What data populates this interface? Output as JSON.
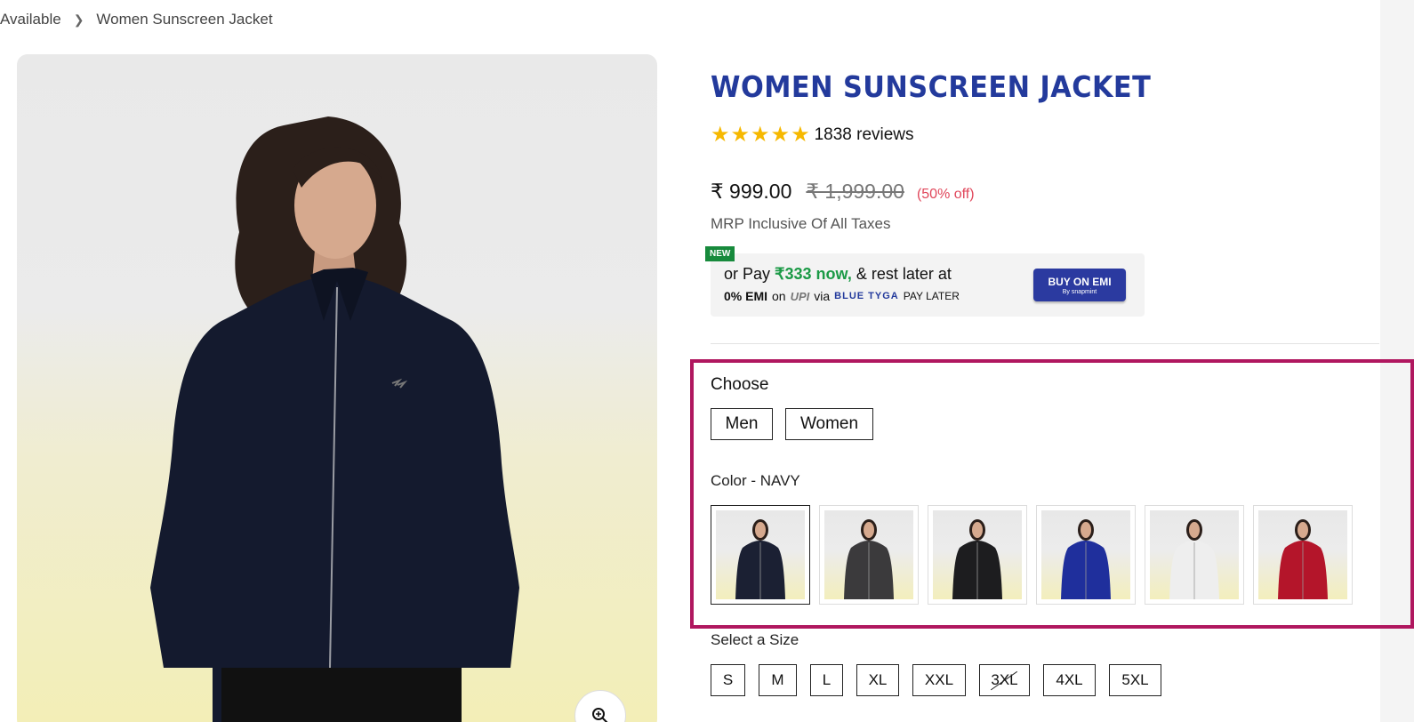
{
  "breadcrumb": {
    "parent": "Available",
    "current": "Women Sunscreen Jacket"
  },
  "product": {
    "title": "WOMEN SUNSCREEN JACKET",
    "rating_stars": 5,
    "reviews": "1838 reviews",
    "price": "₹ 999.00",
    "mrp": "₹ 1,999.00",
    "discount": "(50% off)",
    "tax_note": "MRP Inclusive Of All Taxes"
  },
  "emi": {
    "new_tag": "NEW",
    "line1_prefix": "or Pay ",
    "line1_highlight": "₹333 now,",
    "line1_suffix": " & rest later at",
    "line2_bold": "0% EMI",
    "line2_on": "on",
    "line2_upi": "UPI",
    "line2_via": "via",
    "line2_brand": "BLUE TYGA",
    "line2_paylater": "PAY LATER",
    "button_label": "BUY ON EMI",
    "button_sub": "By snapmint"
  },
  "choose": {
    "label": "Choose",
    "options": [
      "Men",
      "Women"
    ]
  },
  "color": {
    "label": "Color - NAVY",
    "swatches": [
      {
        "name": "navy",
        "color": "#1b2033",
        "selected": true
      },
      {
        "name": "charcoal",
        "color": "#3b3a3c",
        "selected": false
      },
      {
        "name": "black",
        "color": "#1d1d1f",
        "selected": false
      },
      {
        "name": "royal-blue",
        "color": "#1f2f9c",
        "selected": false
      },
      {
        "name": "white",
        "color": "#eeeeee",
        "selected": false
      },
      {
        "name": "red",
        "color": "#b4152a",
        "selected": false
      }
    ]
  },
  "size": {
    "label": "Select a Size",
    "options": [
      "S",
      "M",
      "L",
      "XL",
      "XXL",
      "3XL",
      "4XL",
      "5XL"
    ],
    "unavailable": [
      "3XL"
    ]
  },
  "colors": {
    "brand_blue": "#233a9c",
    "discount_red": "#e0465a",
    "emi_green": "#1b9a46",
    "highlight": "#b0175f",
    "star": "#f6b800"
  }
}
